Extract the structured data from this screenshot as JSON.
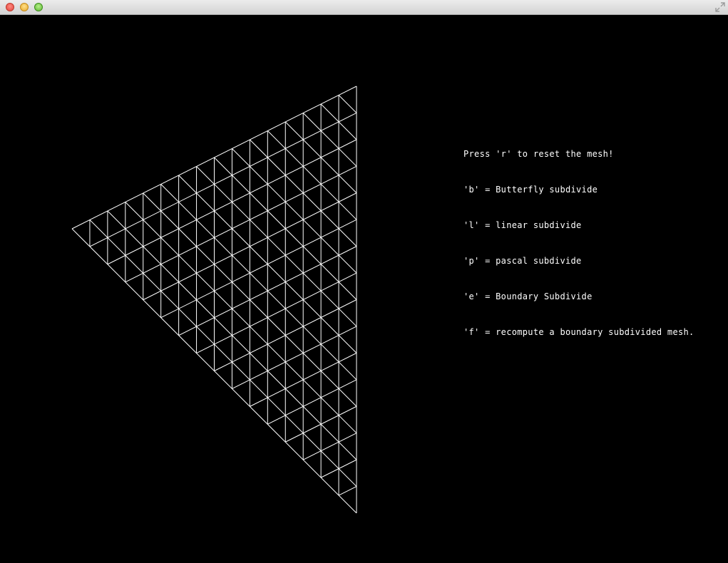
{
  "window": {
    "title": ""
  },
  "instructions": [
    "Press 'r' to reset the mesh!",
    "'b' = Butterfly subdivide",
    "'l' = linear subdivide",
    "'p' = pascal subdivide",
    "'e' = Boundary Subdivide",
    "'f' = recompute a boundary subdivided mesh."
  ],
  "mesh": {
    "subdivisions": 16,
    "line_color": "#ffffff"
  },
  "icons": {
    "close": "close-icon",
    "minimize": "minimize-icon",
    "zoom": "zoom-icon",
    "fullscreen": "fullscreen-icon"
  }
}
